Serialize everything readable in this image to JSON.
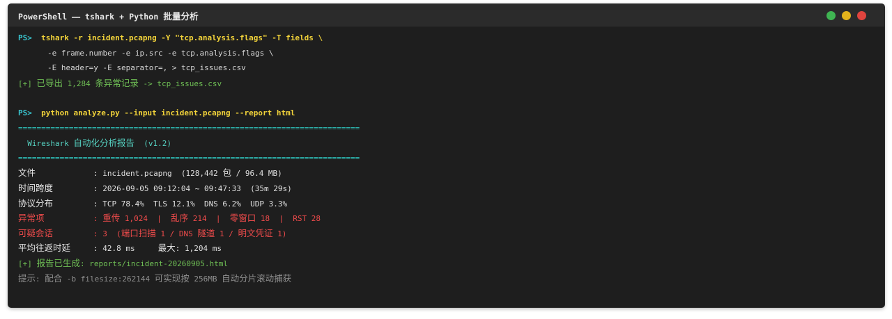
{
  "window": {
    "title_prefix": "PowerShell ⎯⎯ tshark + Python ",
    "title_cjk": "批量分析"
  },
  "cmd1": {
    "prompt": "PS>",
    "line1": "tshark -r incident.pcapng -Y \"tcp.analysis.flags\" -T fields \\",
    "line2": "-e frame.number -e ip.src -e tcp.analysis.flags \\",
    "line3": "-E header=y -E separator=, > tcp_issues.csv",
    "result_prefix": "[+] ",
    "result_cjk1": "已导出",
    "result_count": " 1,284 ",
    "result_cjk2": "条异常记录",
    "result_suffix": " -> tcp_issues.csv"
  },
  "cmd2": {
    "prompt": "PS>",
    "line": "python analyze.py --input incident.pcapng --report html"
  },
  "report": {
    "separator": "==========================================================================",
    "banner_prefix": "  Wireshark ",
    "banner_cjk": "自动化分析报告",
    "banner_suffix": "  (v1.2)",
    "file_label": "文件",
    "file_value_a": ": incident.pcapng  (128,442 ",
    "file_value_cjk": "包",
    "file_value_b": " / 96.4 MB)",
    "time_label": "时间跨度",
    "time_value": ": 2026-09-05 09:12:04 ~ 09:47:33  (35m 29s)",
    "proto_label": "协议分布",
    "proto_value": ": TCP 78.4%  TLS 12.1%  DNS 6.2%  UDP 3.3%",
    "anom_label": "异常项",
    "anom_colon": ": ",
    "anom_retrans_cjk": "重传",
    "anom_retrans": " 1,024  |  ",
    "anom_ooo_cjk": "乱序",
    "anom_ooo": " 214  |  ",
    "anom_zw_cjk": "零窗口",
    "anom_zw": " 18  |  RST 28",
    "sus_label": "可疑会话",
    "sus_a": ": 3  (",
    "sus_scan_cjk": "端口扫描",
    "sus_b": " 1 / DNS ",
    "sus_tunnel_cjk": "隧道",
    "sus_c": " 1 / ",
    "sus_cred_cjk": "明文凭证",
    "sus_d": " 1)",
    "rtt_label": "平均往返时延",
    "rtt_a": ": 42.8 ms     ",
    "rtt_max_cjk": "最大",
    "rtt_b": ": 1,204 ms",
    "gen_prefix": "[+] ",
    "gen_cjk": "报告已生成",
    "gen_suffix": ": reports/incident-20260905.html",
    "hint_cjk1": "提示",
    "hint_a": ": ",
    "hint_cjk2": "配合",
    "hint_b": " -b filesize:262144 ",
    "hint_cjk3": "可实现按",
    "hint_c": " 256MB ",
    "hint_cjk4": "自动分片滚动捕获"
  }
}
